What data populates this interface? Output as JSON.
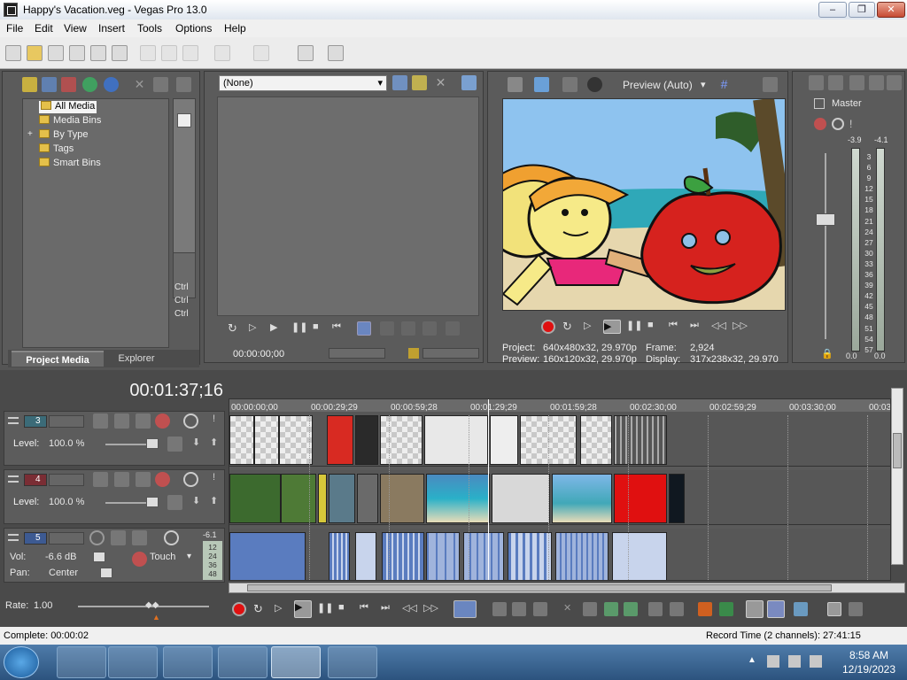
{
  "window": {
    "title": "Happy's Vacation.veg - Vegas Pro 13.0",
    "min": "–",
    "max": "❐",
    "close": "✕"
  },
  "menu": [
    "File",
    "Edit",
    "View",
    "Insert",
    "Tools",
    "Options",
    "Help"
  ],
  "explorer": {
    "tree": [
      "All Media",
      "Media Bins",
      "By Type",
      "Tags",
      "Smart Bins"
    ],
    "ctrl": [
      "Ctrl",
      "Ctrl",
      "Ctrl"
    ],
    "tabs": [
      "Project Media",
      "Explorer"
    ],
    "expand": "+"
  },
  "trimmer": {
    "dropdown": "(None)",
    "timecode": "00:00:00;00"
  },
  "preview": {
    "mode": "Preview (Auto)",
    "project_label": "Project:",
    "project_value": "640x480x32, 29.970p",
    "frame_label": "Frame:",
    "frame_value": "2,924",
    "preview_label": "Preview:",
    "preview_value": "160x120x32, 29.970p",
    "display_label": "Display:",
    "display_value": "317x238x32, 29.970"
  },
  "mixer": {
    "title": "Master",
    "peak_left": "-3.9",
    "peak_right": "-4.1",
    "scale": [
      "3",
      "6",
      "9",
      "12",
      "15",
      "18",
      "21",
      "24",
      "27",
      "30",
      "33",
      "36",
      "39",
      "42",
      "45",
      "48",
      "51",
      "54",
      "57"
    ],
    "bottom_left": "0.0",
    "bottom_right": "0.0"
  },
  "timeline": {
    "cursor": "00:01:37;16",
    "ruler": [
      "00:00:00;00",
      "00:00:29;29",
      "00:00:59;28",
      "00:01:29;29",
      "00:01:59;28",
      "00:02:30;00",
      "00:02:59;29",
      "00:03:30;00",
      "00:03:"
    ],
    "tracks": [
      {
        "num": "3",
        "type": "video",
        "level_label": "Level:",
        "level": "100.0 %",
        "color": "#3b6b78"
      },
      {
        "num": "4",
        "type": "video",
        "level_label": "Level:",
        "level": "100.0 %",
        "color": "#7a2d34"
      },
      {
        "num": "5",
        "type": "audio",
        "vol_label": "Vol:",
        "vol": "-6.6 dB",
        "pan_label": "Pan:",
        "pan": "Center",
        "touch": "Touch",
        "peak": "-6.1",
        "scale": [
          "12",
          "24",
          "36",
          "48"
        ],
        "color": "#3d5a92"
      }
    ],
    "rate_label": "Rate:",
    "rate": "1.00"
  },
  "status": {
    "complete": "Complete: 00:00:02",
    "record_time": "Record Time (2 channels): 27:41:15"
  },
  "taskbar": {
    "time": "8:58 AM",
    "date": "12/19/2023"
  },
  "colors": {
    "accent_red": "#e01010",
    "audio_blue": "#5a7cbf"
  }
}
